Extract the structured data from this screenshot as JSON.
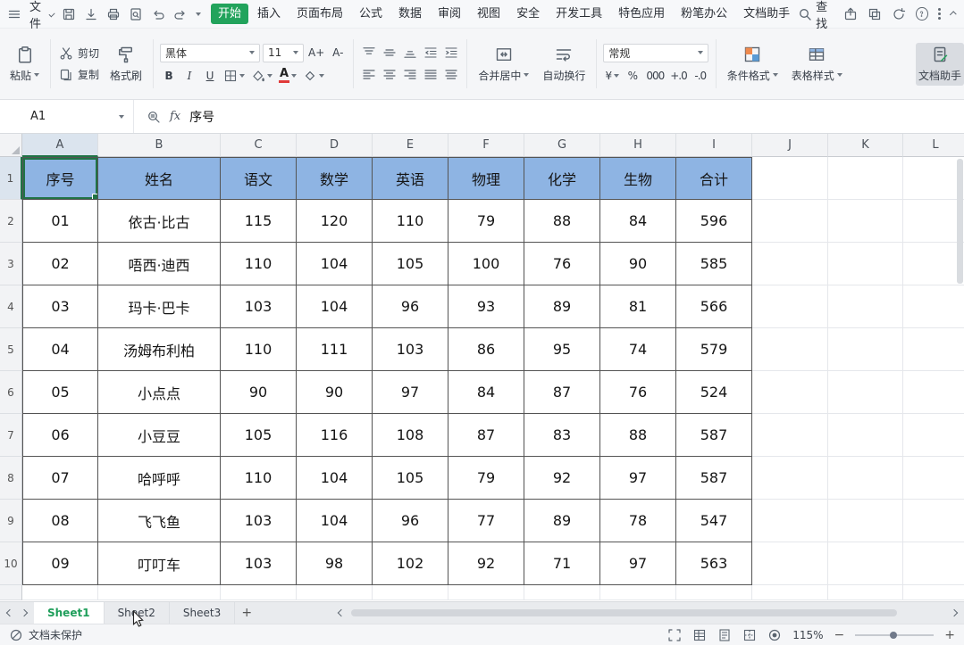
{
  "menu": {
    "file": "文件",
    "tabs": [
      "开始",
      "插入",
      "页面布局",
      "公式",
      "数据",
      "审阅",
      "视图",
      "安全",
      "开发工具",
      "特色应用",
      "粉笔办公",
      "文档助手"
    ],
    "active_tab": "开始",
    "search": "查找"
  },
  "toolbar": {
    "paste": "粘贴",
    "cut": "剪切",
    "copy": "复制",
    "format_painter": "格式刷",
    "font_name": "黑体",
    "font_size": "11",
    "font_increase": "A+",
    "font_decrease": "A-",
    "bold": "B",
    "italic": "I",
    "underline": "U",
    "font_color_glyph": "A",
    "merge_center": "合并居中",
    "wrap_text": "自动换行",
    "number_format": "常规",
    "currency": "¥",
    "percent": "%",
    "thousands": "000",
    "increase_decimal": "+.0",
    "decrease_decimal": "-.0",
    "conditional_format": "条件格式",
    "table_style": "表格样式",
    "doc_assistant": "文档助手"
  },
  "formula_bar": {
    "cell_ref": "A1",
    "fx_label": "fx",
    "content": "序号"
  },
  "grid": {
    "columns": [
      "A",
      "B",
      "C",
      "D",
      "E",
      "F",
      "G",
      "H",
      "I",
      "J",
      "K",
      "L"
    ],
    "selected_column": "A",
    "selected_row": "1",
    "selected_cell": "A1",
    "header_row": [
      "序号",
      "姓名",
      "语文",
      "数学",
      "英语",
      "物理",
      "化学",
      "生物",
      "合计"
    ],
    "data_rows": [
      [
        "01",
        "依古·比古",
        "115",
        "120",
        "110",
        "79",
        "88",
        "84",
        "596"
      ],
      [
        "02",
        "唔西·迪西",
        "110",
        "104",
        "105",
        "100",
        "76",
        "90",
        "585"
      ],
      [
        "03",
        "玛卡·巴卡",
        "103",
        "104",
        "96",
        "93",
        "89",
        "81",
        "566"
      ],
      [
        "04",
        "汤姆布利柏",
        "110",
        "111",
        "103",
        "86",
        "95",
        "74",
        "579"
      ],
      [
        "05",
        "小点点",
        "90",
        "90",
        "97",
        "84",
        "87",
        "76",
        "524"
      ],
      [
        "06",
        "小豆豆",
        "105",
        "116",
        "108",
        "87",
        "83",
        "88",
        "587"
      ],
      [
        "07",
        "哈呼呼",
        "110",
        "104",
        "105",
        "79",
        "92",
        "97",
        "587"
      ],
      [
        "08",
        "飞飞鱼",
        "103",
        "104",
        "96",
        "77",
        "89",
        "78",
        "547"
      ],
      [
        "09",
        "叮叮车",
        "103",
        "98",
        "102",
        "92",
        "71",
        "97",
        "563"
      ]
    ]
  },
  "sheet_bar": {
    "tabs": [
      "Sheet1",
      "Sheet2",
      "Sheet3"
    ],
    "active": "Sheet1",
    "add": "+"
  },
  "status_bar": {
    "protection": "文档未保护",
    "zoom": "115%",
    "zoom_out": "−",
    "zoom_in": "+"
  },
  "colors": {
    "accent_green": "#22a35c",
    "selection_border": "#217346",
    "header_blue": "#8EB4E3",
    "font_color_bar": "#e03a3a"
  }
}
